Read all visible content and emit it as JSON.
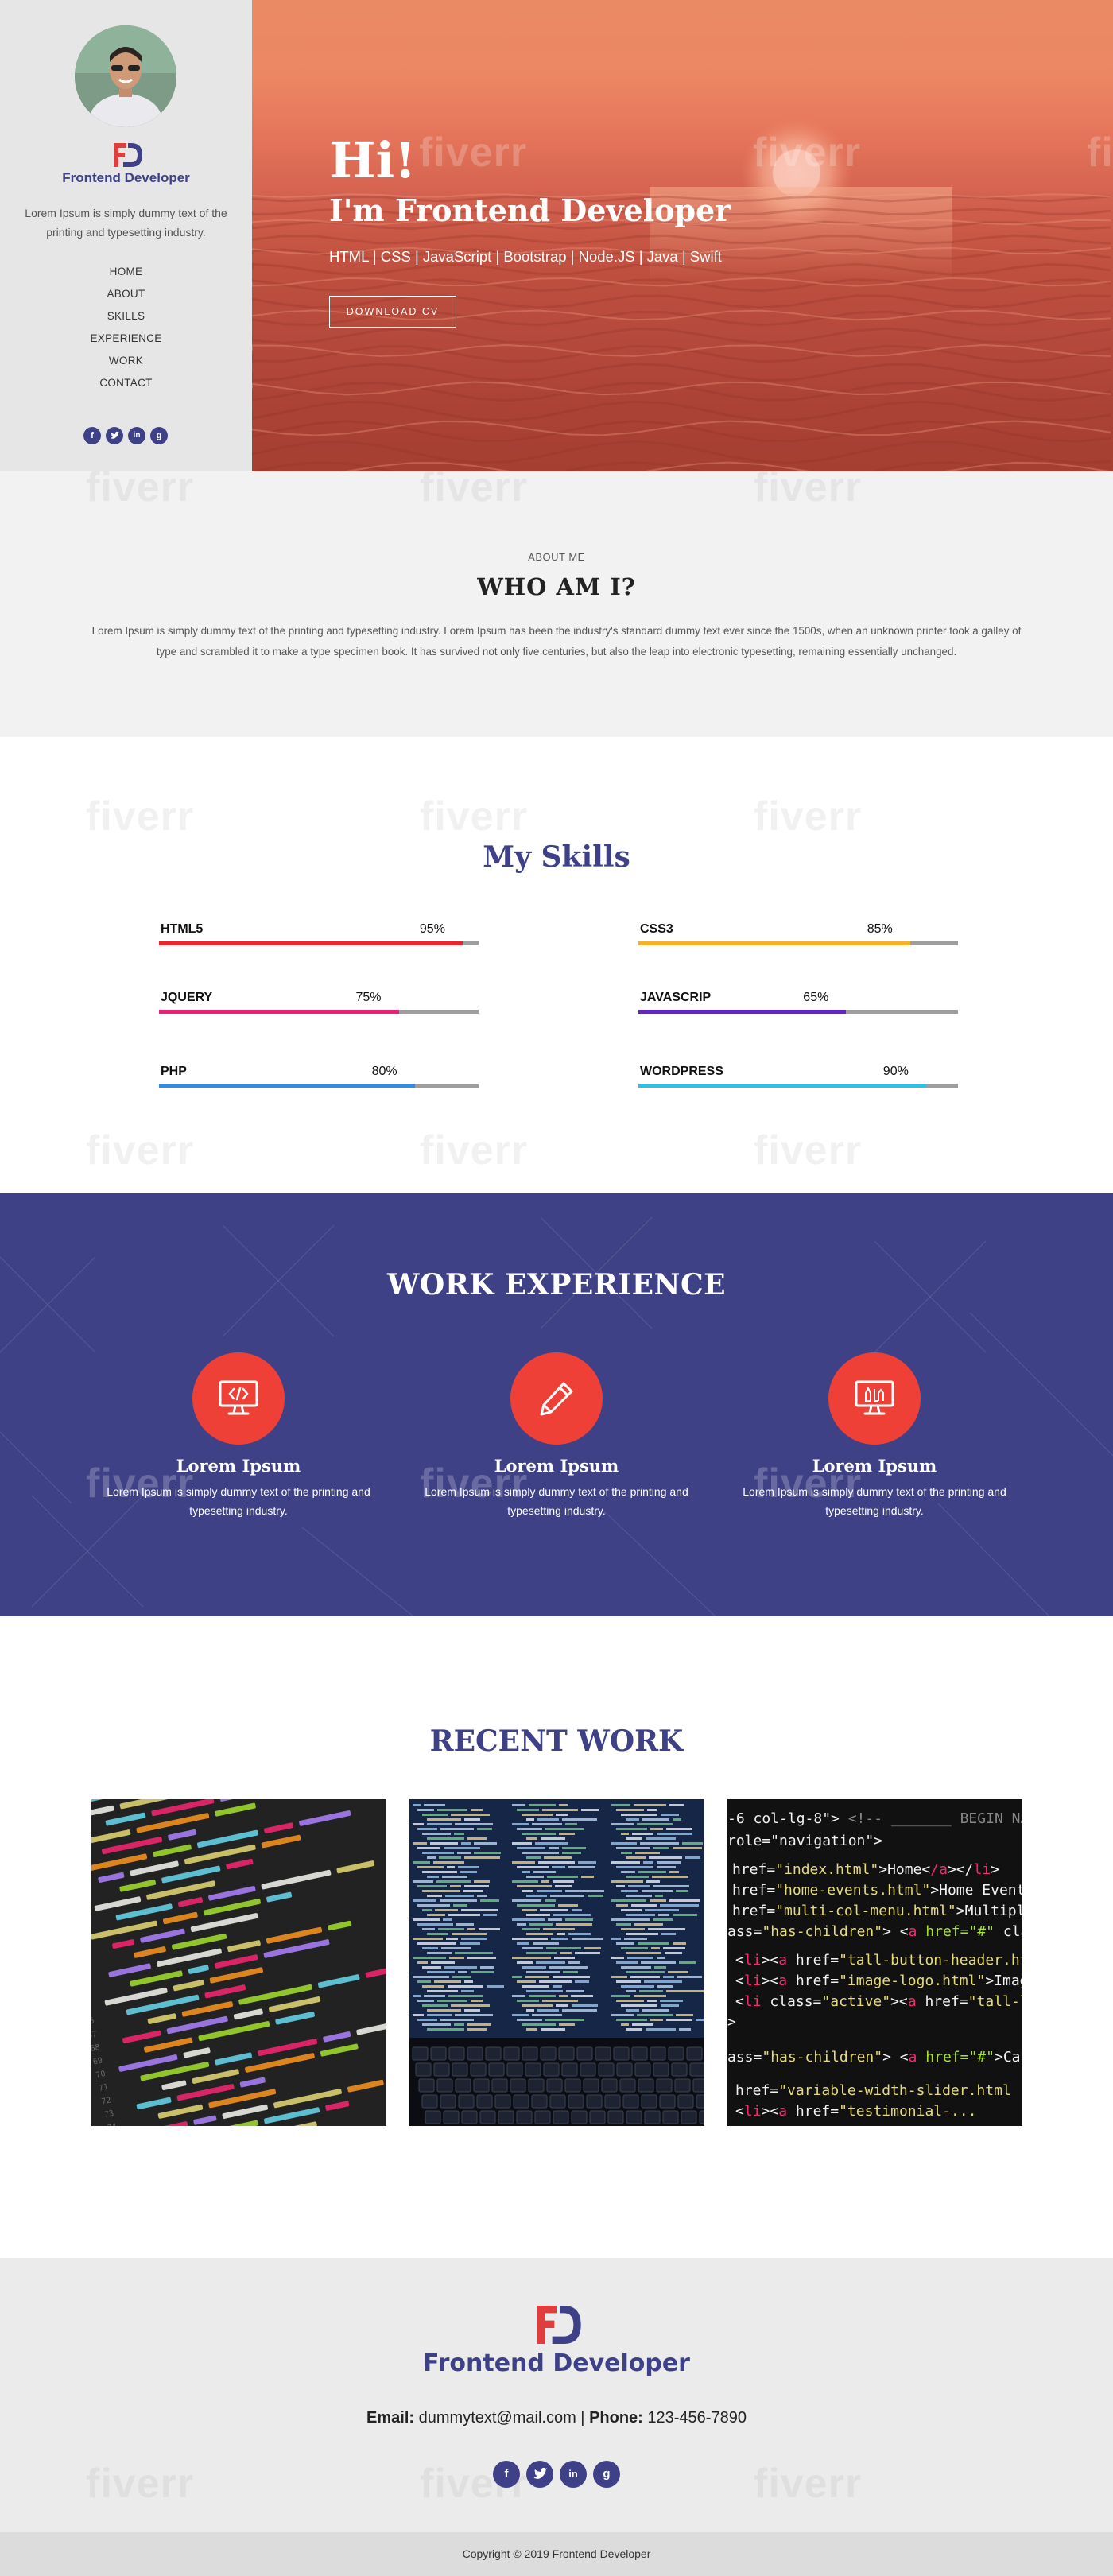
{
  "sidebar": {
    "logo_text": "Frontend Developer",
    "description": "Lorem Ipsum is simply dummy text of the printing and typesetting industry.",
    "nav": [
      "HOME",
      "ABOUT",
      "SKILLS",
      "EXPERIENCE",
      "WORK",
      "CONTACT"
    ],
    "social": [
      "f",
      "t",
      "in",
      "g"
    ]
  },
  "hero": {
    "greeting": "Hi!",
    "title": "I'm Frontend Developer",
    "tech": "HTML | CSS | JavaScript | Bootstrap | Node.JS | Java | Swift",
    "cv_button": "DOWNLOAD CV"
  },
  "about": {
    "kicker": "ABOUT ME",
    "title": "WHO AM I?",
    "text": "Lorem Ipsum is simply dummy text of the printing and typesetting industry. Lorem Ipsum has been the industry's standard dummy text ever since the 1500s, when an unknown printer took a galley of type and scrambled it to make a type specimen book. It has survived not only five centuries, but also the leap into electronic typesetting, remaining essentially unchanged."
  },
  "skills": {
    "title": "My Skills",
    "items": [
      {
        "name": "HTML5",
        "percent": 95,
        "label": "95%",
        "color": "#e8262d"
      },
      {
        "name": "CSS3",
        "percent": 85,
        "label": "85%",
        "color": "#f6b12b"
      },
      {
        "name": "JQUERY",
        "percent": 75,
        "label": "75%",
        "color": "#e8236f"
      },
      {
        "name": "JAVASCRIP",
        "percent": 65,
        "label": "65%",
        "color": "#6027c5"
      },
      {
        "name": "PHP",
        "percent": 80,
        "label": "80%",
        "color": "#2d8ee8"
      },
      {
        "name": "WORDPRESS",
        "percent": 90,
        "label": "90%",
        "color": "#29c3e6"
      }
    ]
  },
  "experience": {
    "title": "WORK EXPERIENCE",
    "cards": [
      {
        "icon": "code-monitor-icon",
        "heading": "Lorem Ipsum",
        "text": "Lorem Ipsum is simply dummy text of the printing and typesetting industry."
      },
      {
        "icon": "pencil-icon",
        "heading": "Lorem Ipsum",
        "text": "Lorem Ipsum is simply dummy text of the printing and typesetting industry."
      },
      {
        "icon": "design-monitor-icon",
        "heading": "Lorem Ipsum",
        "text": "Lorem Ipsum is simply dummy text of the printing and typesetting industry."
      }
    ]
  },
  "work": {
    "title": "RECENT WORK"
  },
  "footer": {
    "logo_text": "Frontend Developer",
    "email_label": "Email:",
    "email": "dummytext@mail.com",
    "separator": " | ",
    "phone_label": "Phone:",
    "phone": "123-456-7890",
    "social": [
      "f",
      "t",
      "in",
      "g"
    ],
    "copyright": "Copyright © 2019 Frontend Developer"
  },
  "colors": {
    "brand": "#3e4188",
    "accent": "#ef4037"
  }
}
